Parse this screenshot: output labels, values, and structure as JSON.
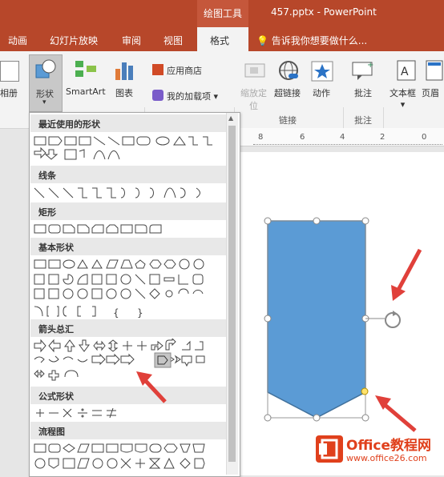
{
  "titlebar": {
    "context_tab": "绘图工具",
    "document": "457.pptx  -  PowerPoint"
  },
  "tabs": [
    {
      "label": "动画"
    },
    {
      "label": "幻灯片放映"
    },
    {
      "label": "审阅"
    },
    {
      "label": "视图"
    },
    {
      "label": "格式"
    }
  ],
  "tell_me": "告诉我你想要做什么...",
  "ribbon": {
    "album": "相册",
    "shapes": "形状",
    "smartart": "SmartArt",
    "chart": "图表",
    "store": "应用商店",
    "my_addins": "我的加载项",
    "zoom": "缩放定",
    "zoom2": "位",
    "hyperlink": "超链接",
    "action": "动作",
    "comment": "批注",
    "textbox": "文本框",
    "header": "页眉",
    "group_links": "链接",
    "group_comments": "批注"
  },
  "ruler": {
    "t1": "8",
    "t2": "6",
    "t3": "4",
    "t4": "2",
    "t5": "0"
  },
  "dropdown": {
    "cat_recent": "最近使用的形状",
    "cat_lines": "线条",
    "cat_rect": "矩形",
    "cat_basic": "基本形状",
    "cat_arrows": "箭头总汇",
    "cat_formula": "公式形状",
    "cat_flow": "流程图"
  },
  "watermark": {
    "brand": "Office教程网",
    "url": "www.office26.com"
  },
  "colors": {
    "accent": "#b7472a",
    "shape_fill": "#5b9bd5",
    "arrow": "#e0403a"
  }
}
